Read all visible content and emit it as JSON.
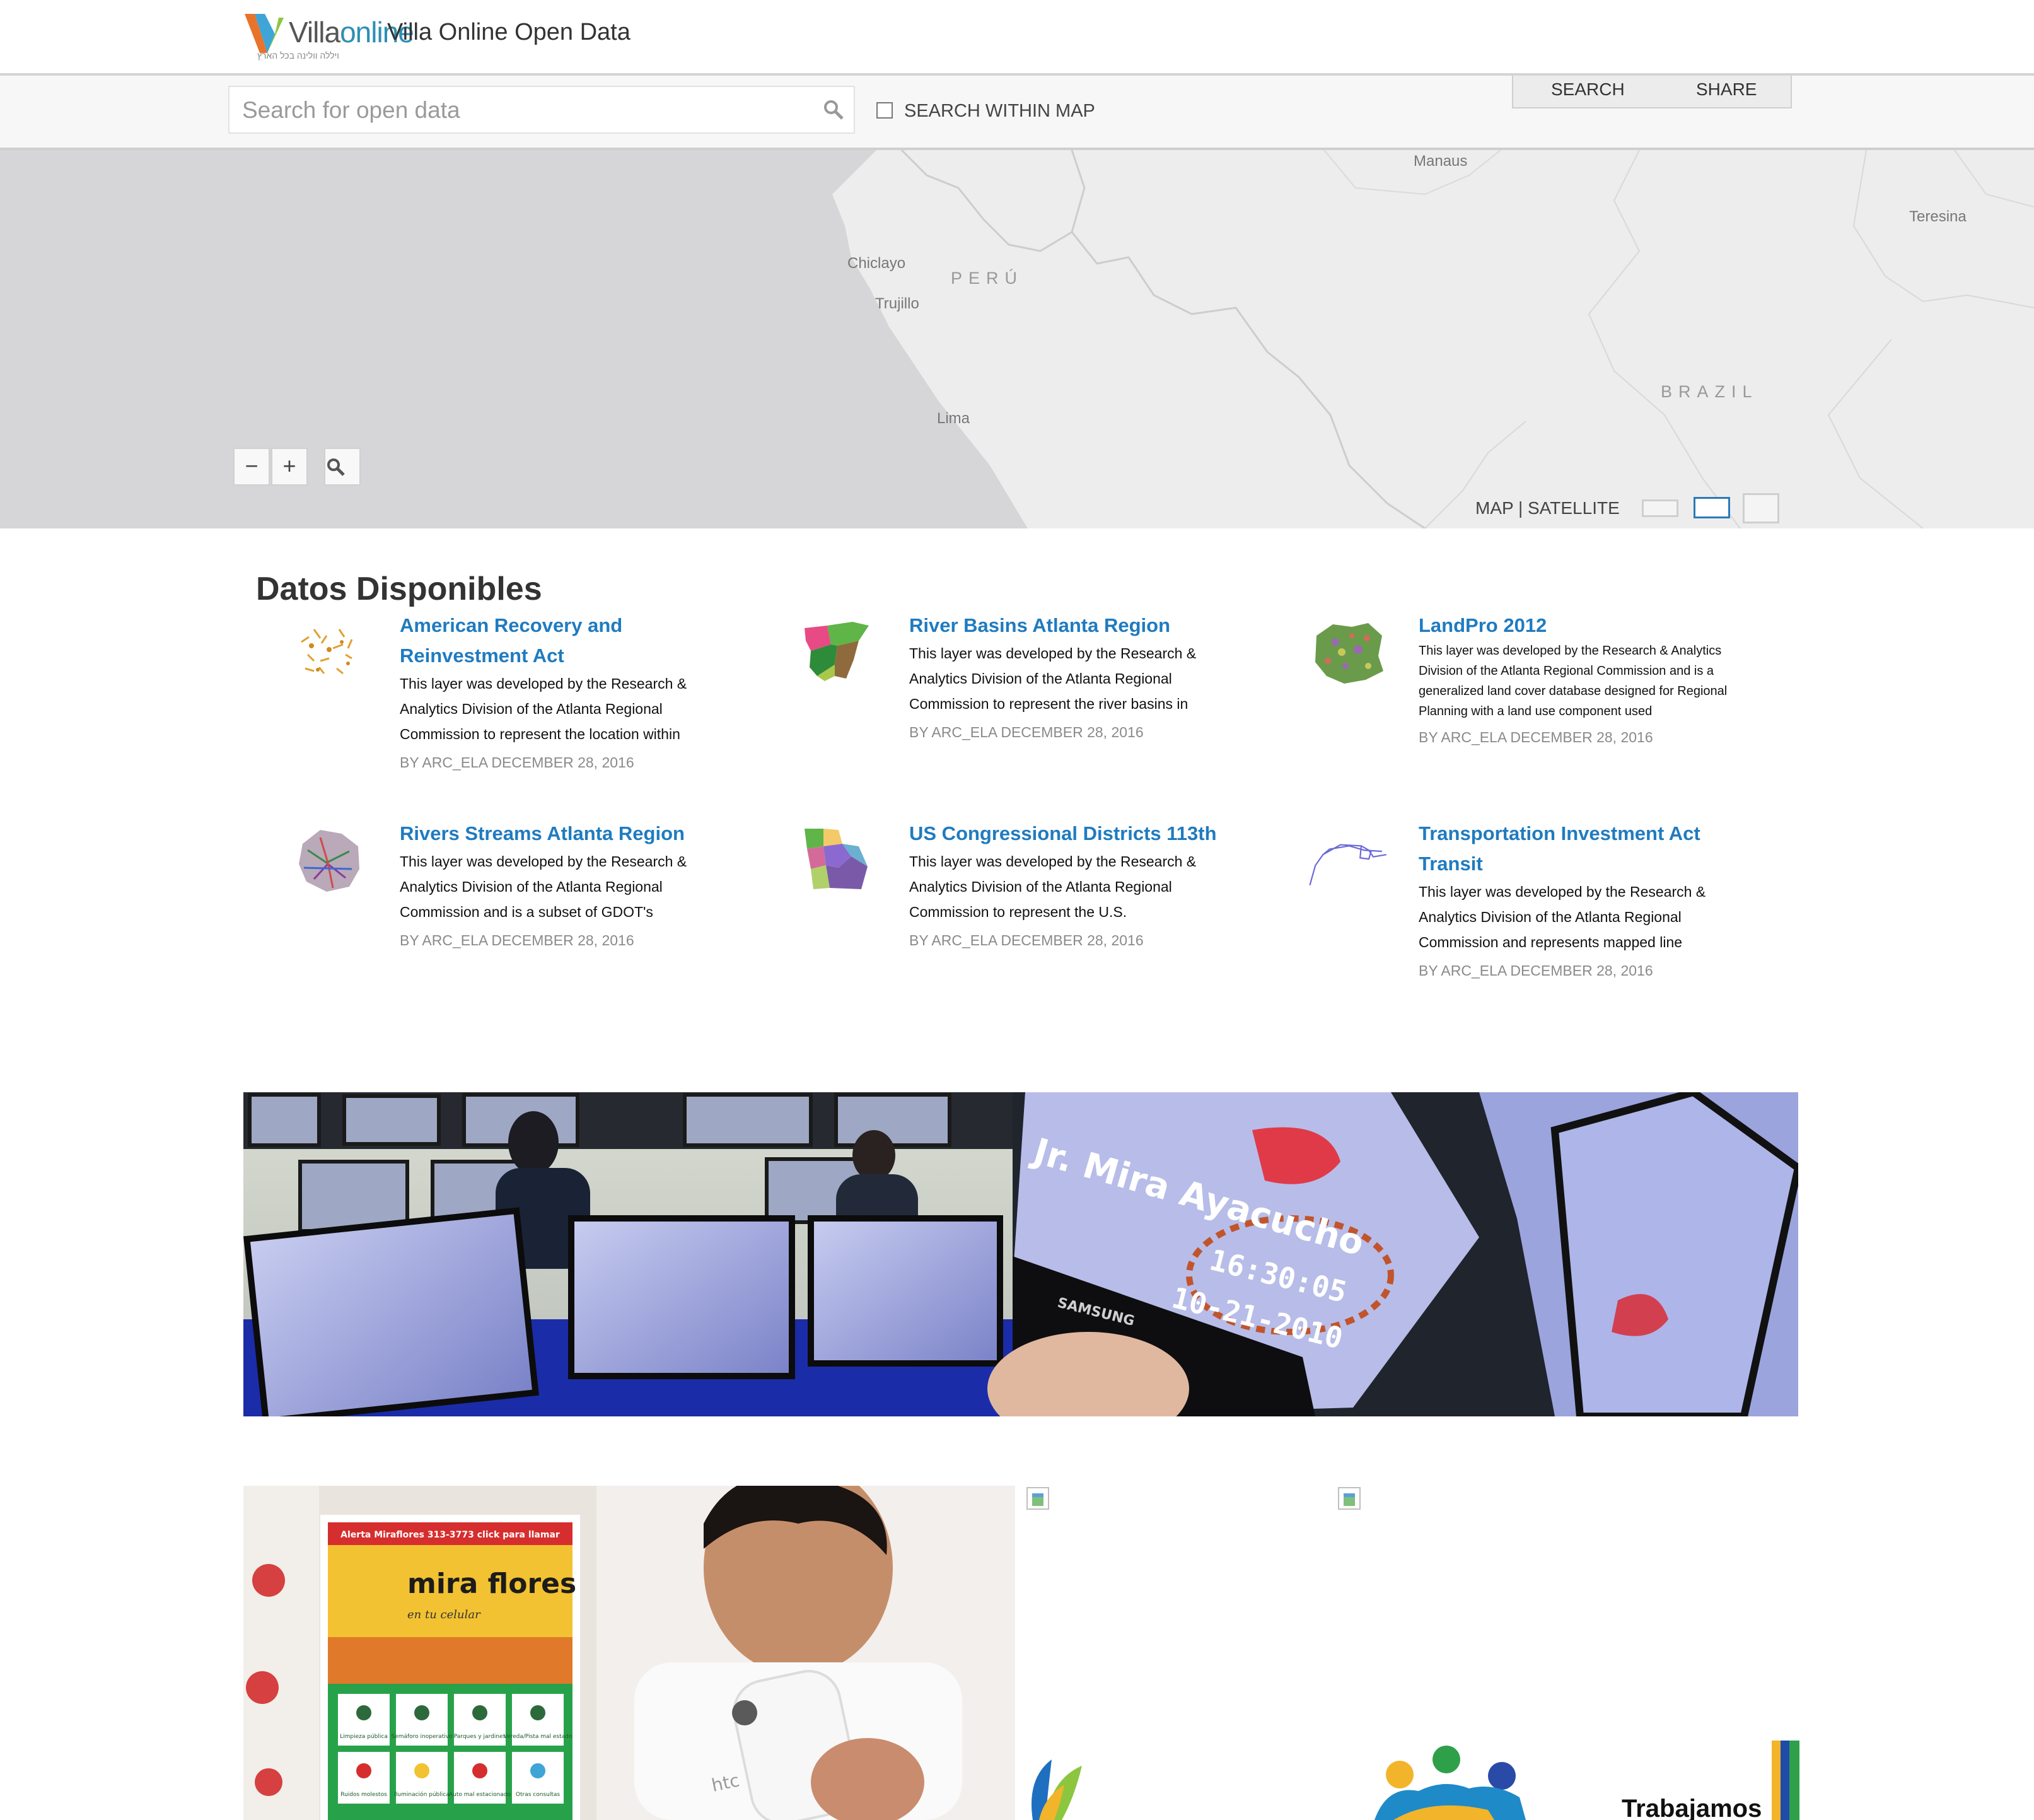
{
  "header": {
    "logo": {
      "text_main": "Villa",
      "text_accent": "online",
      "tagline": "ויללה וולינה בכל הארץ"
    },
    "title": "Villa Online Open Data"
  },
  "search": {
    "placeholder": "Search for open data",
    "value": "",
    "within_map_label": "SEARCH WITHIN MAP",
    "within_map_checked": false,
    "tabs": [
      "SEARCH",
      "SHARE"
    ]
  },
  "map": {
    "labels": [
      "Manaus",
      "Teresina",
      "Chiclayo",
      "Trujillo",
      "Lima"
    ],
    "countries": [
      "PERÚ",
      "BRAZIL"
    ],
    "zoom_out": "−",
    "zoom_in": "+",
    "type_toggle": "MAP | SATELLITE"
  },
  "datasets": {
    "title": "Datos Disponibles",
    "items": [
      {
        "title": "American Recovery and Reinvestment Act",
        "description": "This layer was developed by the Research & Analytics Division of the Atlanta Regional Commission to represent the location within",
        "meta": "BY ARC_ELA DECEMBER 28, 2016",
        "thumb": "scatter-points-icon"
      },
      {
        "title": "River Basins Atlanta Region",
        "description": "This layer was developed by the Research & Analytics Division of the Atlanta Regional Commission to represent the river basins in",
        "meta": "BY ARC_ELA DECEMBER 28, 2016",
        "thumb": "river-basins-map-icon"
      },
      {
        "title": "LandPro 2012",
        "description": "This layer was developed by the Research & Analytics Division of the Atlanta Regional Commission and is a generalized land cover database designed for Regional Planning with a land use component used",
        "meta": "BY ARC_ELA DECEMBER 28, 2016",
        "thumb": "land-cover-map-icon"
      },
      {
        "title": "Rivers Streams Atlanta Region",
        "description": "This layer was developed by the Research & Analytics Division of the Atlanta Regional Commission and is a subset of GDOT's",
        "meta": "BY ARC_ELA DECEMBER 28, 2016",
        "thumb": "streams-map-icon"
      },
      {
        "title": "US Congressional Districts 113th",
        "description": "This layer was developed by the Research & Analytics Division of the Atlanta Regional Commission to represent the U.S.",
        "meta": "BY ARC_ELA DECEMBER 28, 2016",
        "thumb": "districts-map-icon"
      },
      {
        "title": "Transportation Investment Act Transit",
        "description": "This layer was developed by the Research & Analytics Division of the Atlanta Regional Commission and represents mapped line",
        "meta": "BY ARC_ELA DECEMBER 28, 2016",
        "thumb": "transit-lines-icon"
      }
    ]
  },
  "banner": {
    "overlay_street": "Jr. Mira Ayacucho",
    "overlay_time": "16:30:05",
    "overlay_date": "10-21-2010",
    "monitor_brand": "SAMSUNG"
  },
  "photo": {
    "app_header": "Alerta Miraflores 313-3773 click para llamar",
    "app_brand": "mira flores",
    "app_tagline": "en tu celular",
    "app_items": [
      "Limpieza pública",
      "Semáforo inoperativo",
      "Parques y jardines",
      "Vereda/Pista mal estado",
      "Ruidos molestos",
      "Iluminación pública",
      "Auto mal estacionado",
      "Otras consultas"
    ],
    "phone_brand": "htc"
  },
  "promo": {
    "text": "Trabajamos"
  },
  "colors": {
    "link": "#1f7bc0",
    "meta": "#8a8a8a",
    "map_bg": "#ededed",
    "ocean": "#d6d6d8"
  }
}
